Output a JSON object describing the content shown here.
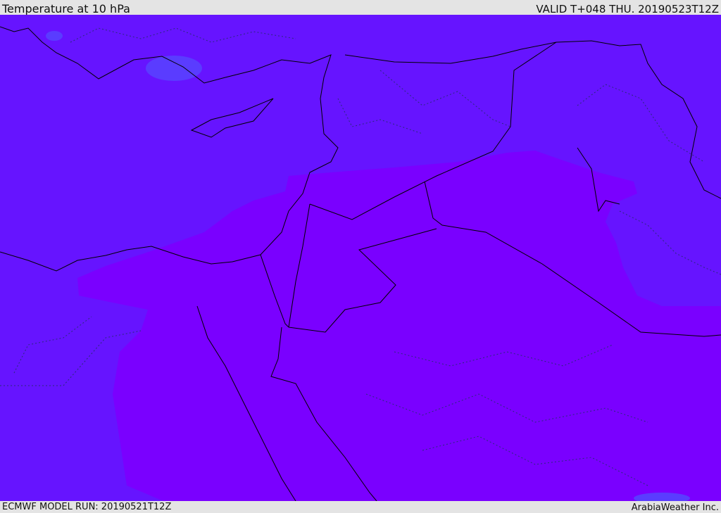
{
  "header": {
    "title": "Temperature at 10 hPa",
    "valid": "VALID T+048 THU. 20190523T12Z"
  },
  "footer": {
    "model_run": "ECMWF MODEL RUN: 20190521T12Z",
    "credit": "ArabiaWeather Inc."
  },
  "map": {
    "region": "Eastern Mediterranean / Middle East",
    "colors": {
      "colder_band": "#6614ff",
      "warmer_band": "#7a00ff",
      "cold_spot": "#5a3cff",
      "land_border": "#000000",
      "internal_border": "#2a2a7a"
    }
  }
}
